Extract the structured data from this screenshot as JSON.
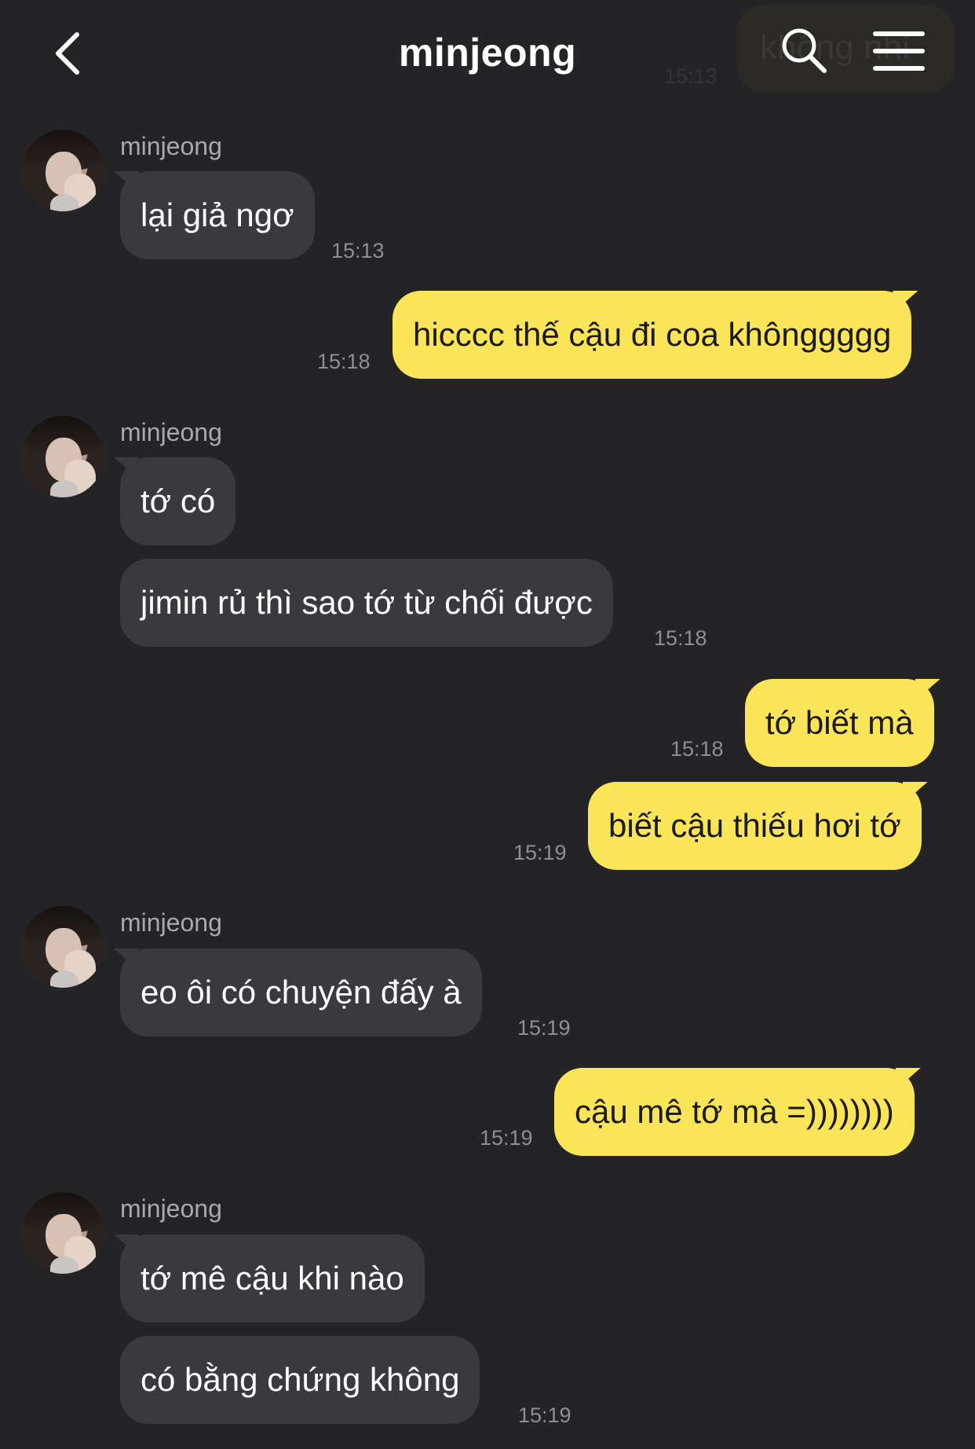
{
  "header": {
    "title": "minjeong",
    "ghost_bubble_text": "không nhỉ",
    "ghost_time": "15:13"
  },
  "messages": [
    {
      "sender": "minjeong",
      "text": "lại giả ngơ",
      "time": "15:13"
    },
    {
      "text": "hicccc thế cậu đi coa khônggggg",
      "time": "15:18"
    },
    {
      "sender": "minjeong",
      "text": "tớ có"
    },
    {
      "text": "jimin rủ thì sao tớ từ chối được",
      "time": "15:18"
    },
    {
      "text": "tớ biết mà",
      "time": "15:18"
    },
    {
      "text": "biết cậu thiếu hơi tớ",
      "time": "15:19"
    },
    {
      "sender": "minjeong",
      "text": "eo ôi có chuyện đấy à",
      "time": "15:19"
    },
    {
      "text": "cậu mê tớ mà =))))))))",
      "time": "15:19"
    },
    {
      "sender": "minjeong",
      "text": "tớ mê cậu khi nào"
    },
    {
      "text": "có bằng chứng không",
      "time": "15:19"
    }
  ],
  "icons": {
    "back": "chevron-left-icon",
    "search": "search-icon",
    "menu": "hamburger-menu-icon",
    "avatar": "avatar"
  },
  "colors": {
    "background": "#242427",
    "incoming_bubble": "#3a3a3e",
    "outgoing_bubble": "#fae458",
    "timestamp": "#8e8e93"
  }
}
